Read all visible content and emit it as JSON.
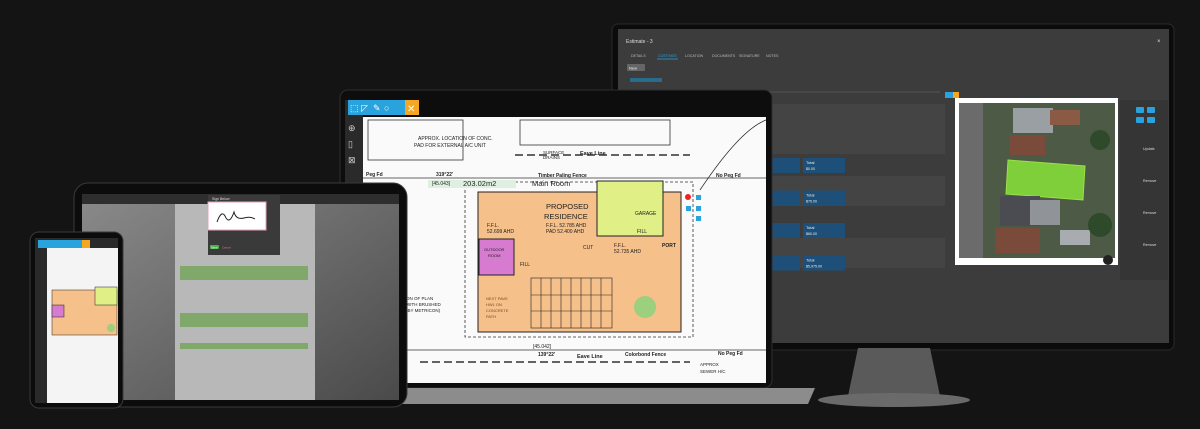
{
  "monitor": {
    "title": "Estimate - 3",
    "tabs": [
      "DETAILS",
      "COSTINGS",
      "LOCATION",
      "DOCUMENTS",
      "SIGNATURE",
      "NOTES"
    ],
    "new_button": "New",
    "rows": [
      {
        "label": "Total",
        "value": "$0.00"
      },
      {
        "label": "Total",
        "value": "$75.00"
      },
      {
        "label": "Total",
        "value": "$60.00"
      },
      {
        "label": "Total",
        "value": "$5,975.00"
      }
    ],
    "side_labels": [
      "Update",
      "Remove",
      "Remove",
      "Remove"
    ],
    "accent": "#1e9bd7"
  },
  "laptop": {
    "plan": {
      "note_ac": [
        "APPROX. LOCATION OF CONC.",
        "PAD FOR EXTERNAL A/C UNIT"
      ],
      "surface_drains": [
        "SURFACE",
        "DRAINS"
      ],
      "eave_line_top": "Eave Line",
      "eave_line_bottom": "Eave Line",
      "peg_fd": "Peg Fd",
      "bearing_top": "319°22'",
      "dist_top": "[45.043]",
      "area": "203.02m2",
      "room_name": "Main Room",
      "fence_top": "Timber Paling Fence",
      "no_peg_top": "No Peg Fd",
      "no_peg_bottom": "No Peg Fd",
      "residence": [
        "PROPOSED",
        "RESIDENCE"
      ],
      "ffl_main": [
        "F.F.L. 52.785 AHD",
        "PAD 52.400 AHD"
      ],
      "ffl_left": [
        "F.F.L.",
        "52.699 AHD"
      ],
      "ffl_right": [
        "F.F.L.",
        "52.735 AHD"
      ],
      "garage": "GARAGE",
      "fill": "FILL",
      "cut": "CUT",
      "outdoor": [
        "OUTDOOR",
        "ROOM"
      ],
      "port": "PORT",
      "dist_bottom": "[45.042]",
      "bearing_bottom": "139°22'",
      "fence_bottom": "Colorbond Fence",
      "sewer": [
        "APPROX",
        "SEWER H/C"
      ],
      "path_note": [
        "NEXT PAVE",
        "HWL ON",
        "CONCRETE",
        "PATH"
      ],
      "plan_note": [
        "ON OF PLAN",
        "WITH BRUSHED",
        "(BY METRICON)"
      ]
    },
    "toolbar_color": "#29a3dd",
    "highlight_color": "#f5a623"
  },
  "tablet": {
    "dialog_title": "Sign Below",
    "save_button": "Save",
    "cancel_button": "Cancel"
  }
}
